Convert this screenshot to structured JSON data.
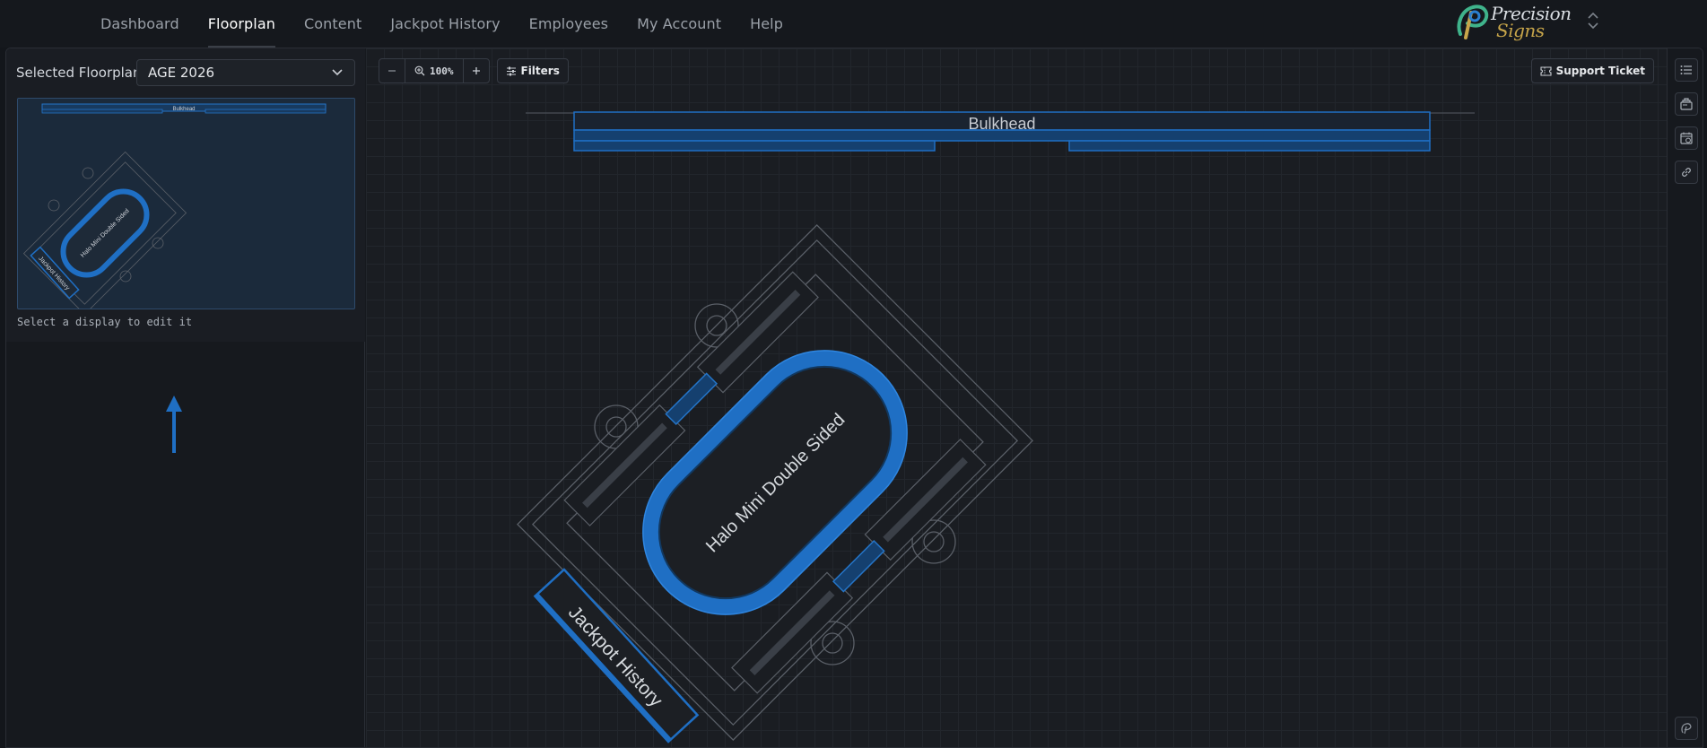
{
  "nav": {
    "items": [
      {
        "label": "Dashboard",
        "active": false
      },
      {
        "label": "Floorplan",
        "active": true
      },
      {
        "label": "Content",
        "active": false
      },
      {
        "label": "Jackpot History",
        "active": false
      },
      {
        "label": "Employees",
        "active": false
      },
      {
        "label": "My Account",
        "active": false
      },
      {
        "label": "Help",
        "active": false
      }
    ]
  },
  "logo": {
    "line1": "Precision",
    "line2": "Signs",
    "icon": "precision-signs-logo"
  },
  "left": {
    "selected_label": "Selected Floorplan",
    "selected_value": "AGE 2026",
    "hint": "Select a display to edit it"
  },
  "toolbar": {
    "zoom_value": "100%",
    "filters_label": "Filters",
    "support_label": "Support Ticket"
  },
  "floor": {
    "bulkhead_label": "Bulkhead",
    "table_label": "Halo Mini Double Sided",
    "jackpot_label": "Jackpot History"
  },
  "thumbnail": {
    "bulkhead_label": "Bulkhead",
    "table_label": "Halo Mini Double Sided",
    "jackpot_label": "Jackpot History"
  },
  "rail": {
    "icons": [
      "list-icon",
      "layers-icon",
      "calendar-clock-icon",
      "link-icon",
      "logo-mark-icon"
    ]
  },
  "colors": {
    "accent": "#1f6fc4",
    "accent_dark": "#15406f",
    "background": "#13161b"
  }
}
